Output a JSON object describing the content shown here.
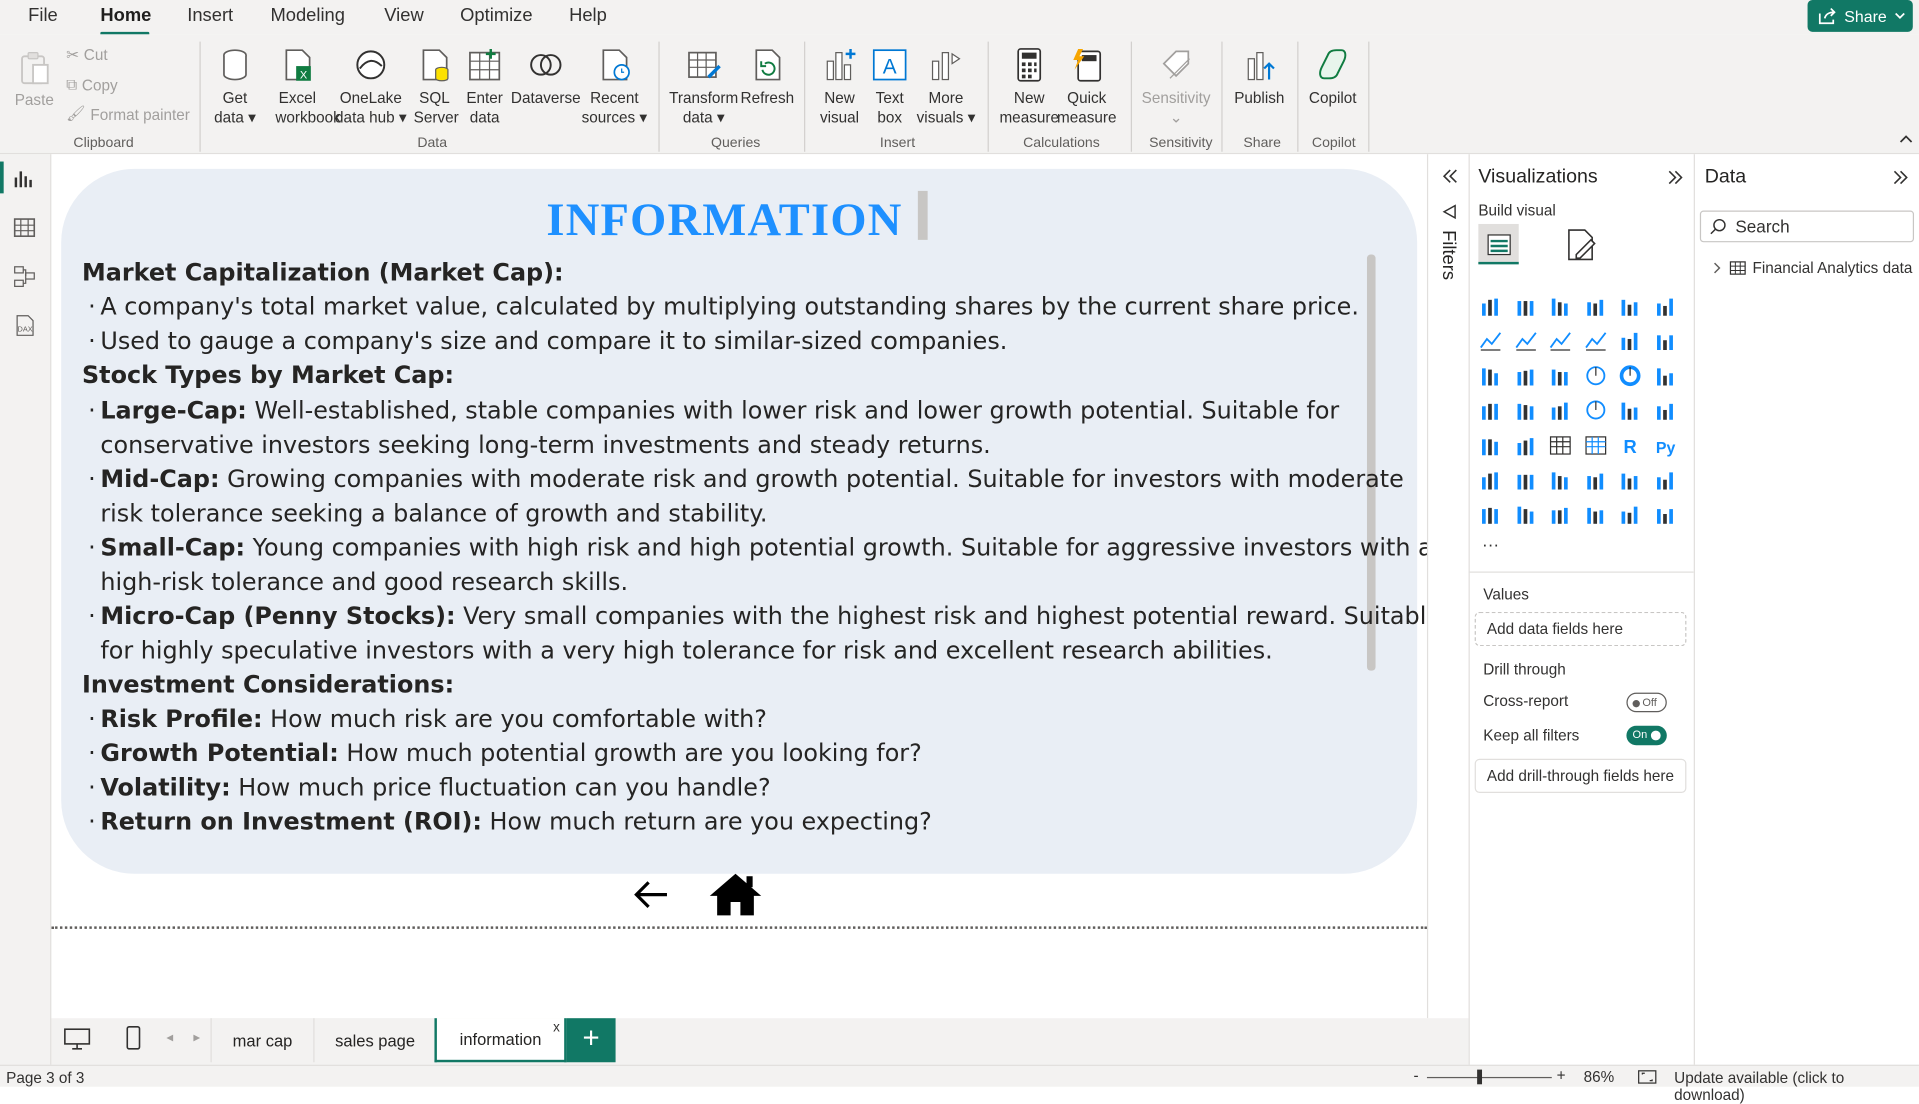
{
  "menu": {
    "file": "File",
    "home": "Home",
    "insert": "Insert",
    "modeling": "Modeling",
    "view": "View",
    "optimize": "Optimize",
    "help": "Help",
    "share": "Share"
  },
  "ribbon": {
    "paste": "Paste",
    "cut": "Cut",
    "copy": "Copy",
    "format_painter": "Format painter",
    "clipboard": "Clipboard",
    "get_data_1": "Get",
    "get_data_2": "data",
    "excel_1": "Excel",
    "excel_2": "workbook",
    "onelake_1": "OneLake",
    "onelake_2": "data hub",
    "sql_1": "SQL",
    "sql_2": "Server",
    "enter_1": "Enter",
    "enter_2": "data",
    "dataverse": "Dataverse",
    "recent_1": "Recent",
    "recent_2": "sources",
    "data_group": "Data",
    "transform_1": "Transform",
    "transform_2": "data",
    "refresh": "Refresh",
    "queries": "Queries",
    "new_visual_1": "New",
    "new_visual_2": "visual",
    "text_box_1": "Text",
    "text_box_2": "box",
    "more_visuals_1": "More",
    "more_visuals_2": "visuals",
    "insert_group": "Insert",
    "new_measure_1": "New",
    "new_measure_2": "measure",
    "quick_measure_1": "Quick",
    "quick_measure_2": "measure",
    "calculations": "Calculations",
    "sensitivity": "Sensitivity",
    "sensitivity_group": "Sensitivity",
    "publish": "Publish",
    "share_group": "Share",
    "copilot": "Copilot",
    "copilot_group": "Copilot"
  },
  "content": {
    "title": "INFORMATION",
    "h1": "Market Capitalization (Market Cap):",
    "b1": "A company's total market value, calculated by multiplying outstanding shares by the current share price.",
    "b2": "Used to gauge a company's size and compare it to similar-sized companies.",
    "h2": "Stock Types by Market Cap:",
    "large_label": "Large-Cap:",
    "large_text": " Well-established, stable companies with lower risk and lower growth potential. Suitable for",
    "large_text2": "conservative investors seeking long-term investments and steady returns.",
    "mid_label": "Mid-Cap:",
    "mid_text": " Growing companies with moderate risk and growth potential. Suitable for investors with moderate",
    "mid_text2": "risk tolerance seeking a balance of growth and stability.",
    "small_label": "Small-Cap:",
    "small_text": " Young companies with high risk and high potential growth. Suitable for aggressive investors with a",
    "small_text2": "high-risk tolerance and good research skills.",
    "micro_label": "Micro-Cap (Penny Stocks):",
    "micro_text": " Very small companies with the highest risk and highest potential reward.  Suitable",
    "micro_text2": "for highly speculative investors with a very high tolerance for risk and excellent research abilities.",
    "h3": "Investment Considerations:",
    "risk_label": "Risk Profile:",
    "risk_text": " How much risk are you comfortable with?",
    "growth_label": "Growth Potential:",
    "growth_text": " How much potential growth are you looking for?",
    "vol_label": "Volatility:",
    "vol_text": " How much price fluctuation can you handle?",
    "roi_label": "Return on Investment (ROI):",
    "roi_text": " How much return are you expecting?"
  },
  "filters_label": "Filters",
  "viz": {
    "title": "Visualizations",
    "build": "Build visual",
    "values": "Values",
    "add_data": "Add data fields here",
    "drill": "Drill through",
    "cross": "Cross-report",
    "cross_state": "Off",
    "keep": "Keep all filters",
    "keep_state": "On",
    "add_drill": "Add drill-through fields here",
    "more": "···"
  },
  "data_pane": {
    "title": "Data",
    "search_placeholder": "Search",
    "table": "Financial Analytics data"
  },
  "tabs": [
    {
      "label": "mar cap"
    },
    {
      "label": "sales page"
    },
    {
      "label": "information"
    }
  ],
  "add_tab": "+",
  "close_tab": "x",
  "status": {
    "page": "Page 3 of 3",
    "zoom": "86%",
    "update": "Update available (click to download)",
    "zoom_minus": "-",
    "zoom_plus": "+"
  },
  "colors": {
    "accent": "#117865",
    "title": "#1e90ff",
    "card": "#e9eef5"
  }
}
